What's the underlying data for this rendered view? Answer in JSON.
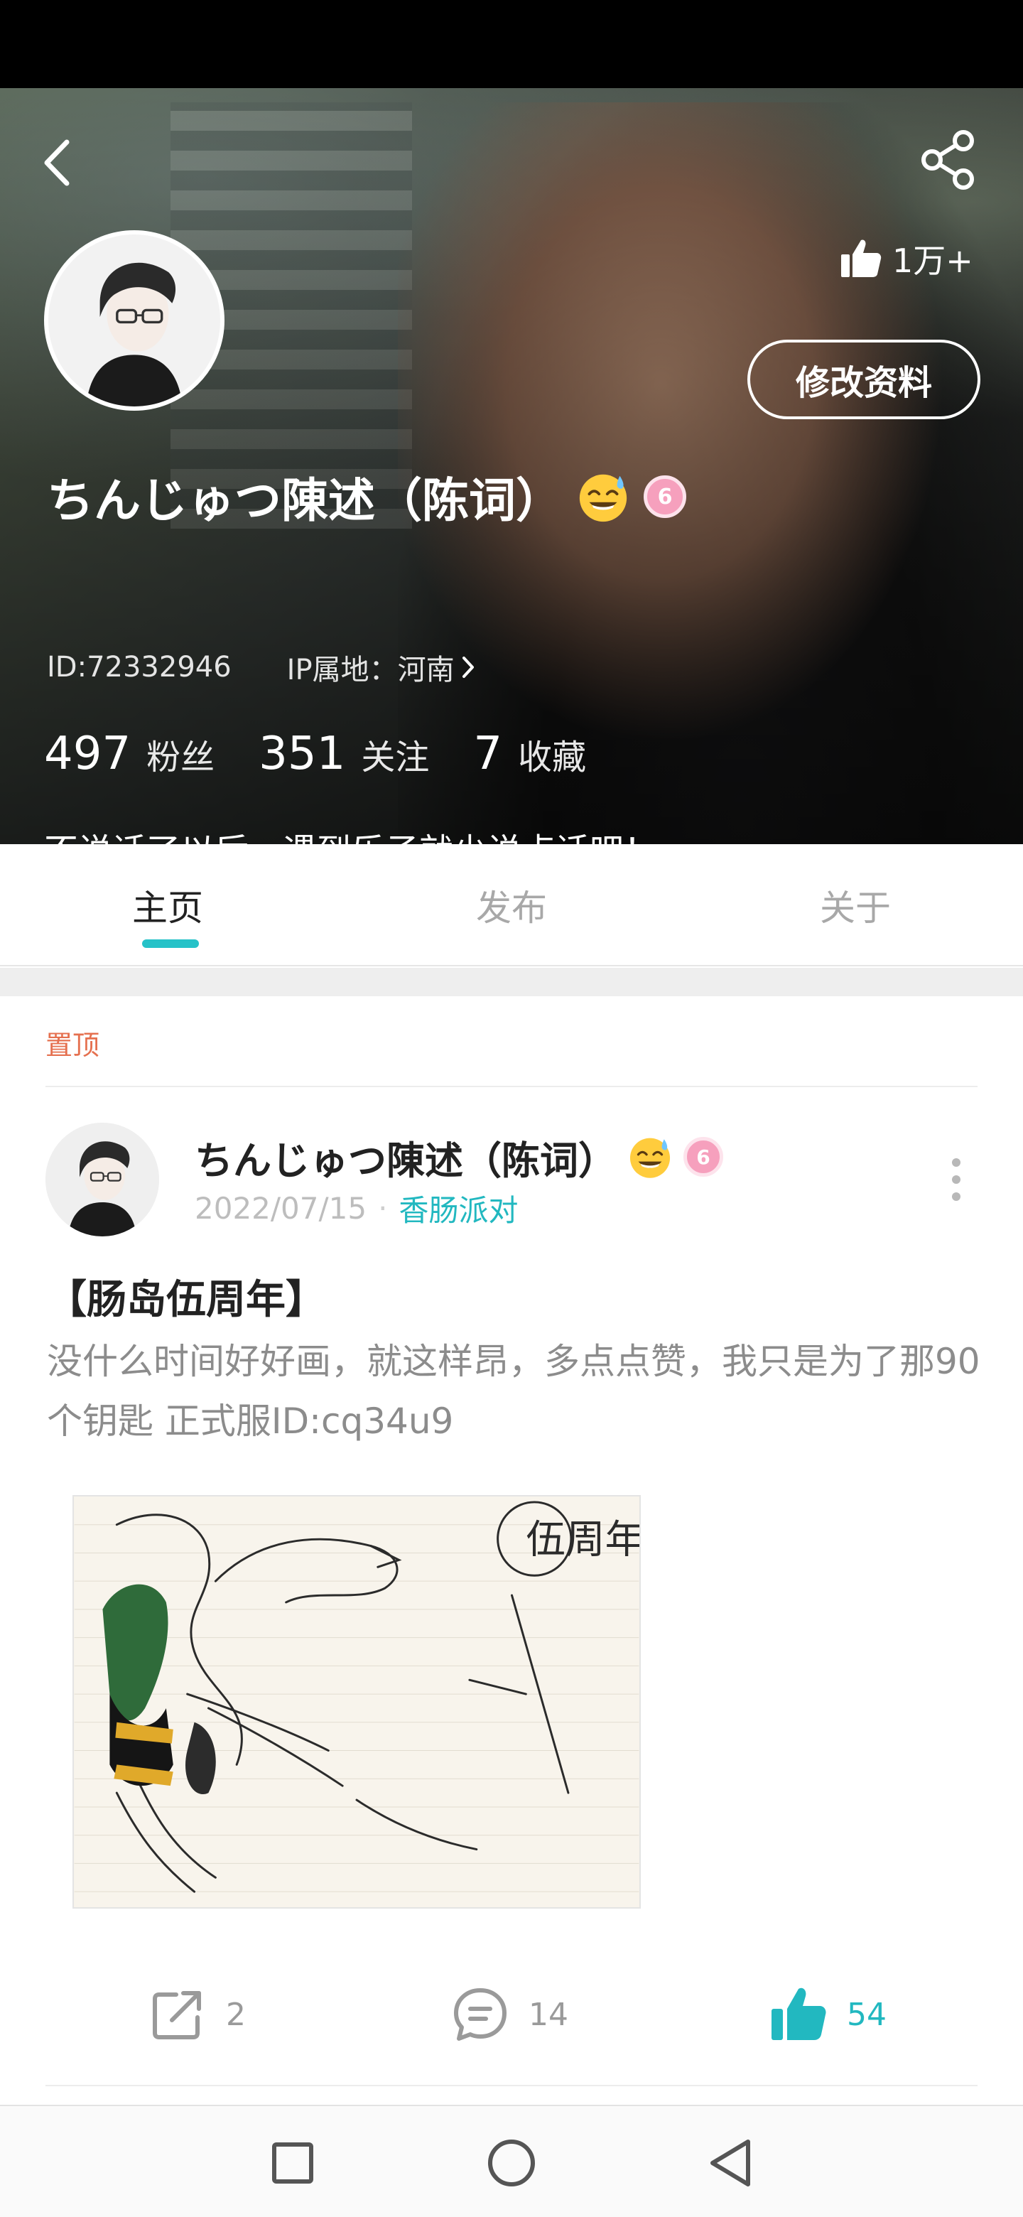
{
  "profile": {
    "username": "ちんじゅつ陳述（陈词）",
    "emoji": "😅",
    "badge": "6",
    "id_text": "ID:72332946",
    "ip_text": "IP属地：河南",
    "likes": "1万+",
    "edit_label": "修改资料",
    "bio": "不说话了以后，遇到乐子就少说点话吧！",
    "stats": [
      {
        "num": "497",
        "label": "粉丝"
      },
      {
        "num": "351",
        "label": "关注"
      },
      {
        "num": "7",
        "label": "收藏"
      }
    ]
  },
  "tabs": [
    {
      "label": "主页",
      "active": true
    },
    {
      "label": "发布",
      "active": false
    },
    {
      "label": "关于",
      "active": false
    }
  ],
  "feed": {
    "pinned_label": "置顶",
    "post": {
      "author": "ちんじゅつ陳述（陈词）",
      "date": "2022/07/15",
      "separator": "·",
      "group": "香肠派对",
      "title": "【肠岛伍周年】",
      "text": "没什么时间好好画，就这样昂，多点点赞，我只是为了那90个钥匙 正式服ID:cq34u9",
      "image_caption": "伍周年快乐",
      "actions": {
        "share_count": "2",
        "comment_count": "14",
        "like_count": "54"
      }
    }
  },
  "icons": {
    "back": "chevron-left-icon",
    "share": "share-icon",
    "thumb": "thumbs-up-icon",
    "more": "more-vertical-icon",
    "comment": "comment-icon",
    "nav_recent": "square-icon",
    "nav_home": "circle-icon",
    "nav_back": "triangle-back-icon"
  },
  "colors": {
    "accent": "#22b8c0",
    "pinned": "#e5704f",
    "badge": "#f6a0bd"
  }
}
